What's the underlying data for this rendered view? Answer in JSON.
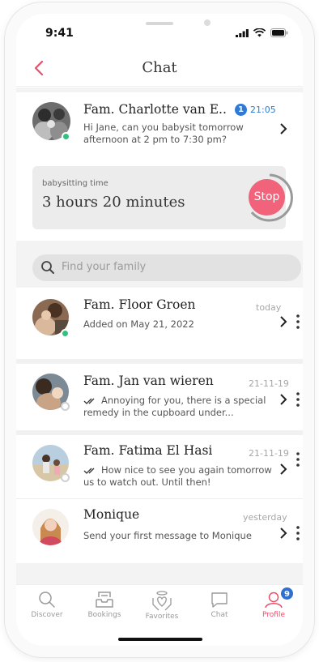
{
  "status_bar": {
    "time": "9:41"
  },
  "header": {
    "title": "Chat"
  },
  "active_chat": {
    "name": "Fam. Charlotte van E..",
    "unread_count": "1",
    "time": "21:05",
    "message": "Hi Jane, can you babysit tomorrow afternoon at 2 pm to 7:30 pm?",
    "online": true
  },
  "babysitting": {
    "label": "babysitting time",
    "duration": "3 hours 20 minutes",
    "stop_label": "Stop"
  },
  "search": {
    "placeholder": "Find your family"
  },
  "conversations": [
    {
      "name": "Fam. Floor Groen",
      "date": "today",
      "message": "Added on May 21, 2022",
      "online": true,
      "read_ticks": false
    },
    {
      "name": "Fam. Jan van wieren",
      "date": "21-11-19",
      "message": "Annoying for you, there is a special remedy in the cupboard under...",
      "online": false,
      "read_ticks": true
    },
    {
      "name": "Fam. Fatima El Hasi",
      "date": "21-11-19",
      "message": "How nice to see you again tomorrow us to watch out. Until then!",
      "online": false,
      "read_ticks": true
    },
    {
      "name": "Monique",
      "date": "yesterday",
      "message": "Send your first message to Monique",
      "online": false,
      "read_ticks": false
    }
  ],
  "tabs": [
    {
      "label": "Discover",
      "icon": "search-icon"
    },
    {
      "label": "Bookings",
      "icon": "inbox-icon"
    },
    {
      "label": "Favorites",
      "icon": "heart-hands-icon"
    },
    {
      "label": "Chat",
      "icon": "speech-bubble-icon"
    },
    {
      "label": "Profile",
      "icon": "profile-icon",
      "badge": "9",
      "active": true
    }
  ],
  "colors": {
    "accent_pink": "#f0637b",
    "badge_blue": "#2f7ad6",
    "online_green": "#2fc27d"
  }
}
